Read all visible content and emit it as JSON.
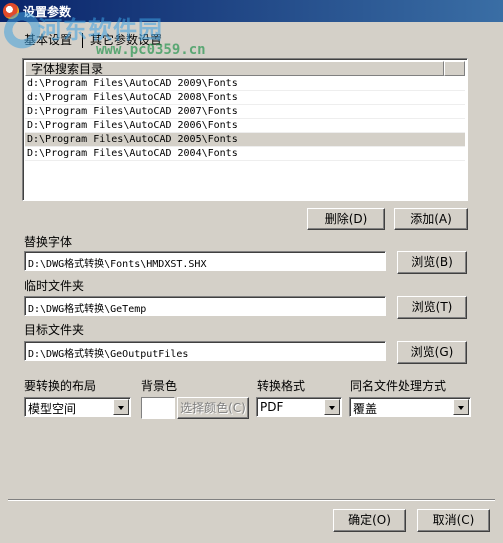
{
  "window": {
    "title": "设置参数"
  },
  "watermark": {
    "text": "河东软件园",
    "url": "www.pc0359.cn"
  },
  "tabs": [
    {
      "label": "基本设置"
    },
    {
      "label": "其它参数设置"
    }
  ],
  "font_dirs": {
    "header": "字体搜索目录",
    "rows": [
      "d:\\Program Files\\AutoCAD 2009\\Fonts",
      "d:\\Program Files\\AutoCAD 2008\\Fonts",
      "D:\\Program Files\\AutoCAD 2007\\Fonts",
      "D:\\Program Files\\AutoCAD 2006\\Fonts",
      "D:\\Program Files\\AutoCAD 2005\\Fonts",
      "D:\\Program Files\\AutoCAD 2004\\Fonts"
    ],
    "selected_index": 4,
    "delete_label": "删除(D)",
    "add_label": "添加(A)"
  },
  "replace_font": {
    "label": "替换字体",
    "value": "D:\\DWG格式转换\\Fonts\\HMDXST.SHX",
    "browse_label": "浏览(B)"
  },
  "temp_folder": {
    "label": "临时文件夹",
    "value": "D:\\DWG格式转换\\GeTemp",
    "browse_label": "浏览(T)"
  },
  "target_folder": {
    "label": "目标文件夹",
    "value": "D:\\DWG格式转换\\GeOutputFiles",
    "browse_label": "浏览(G)"
  },
  "layout": {
    "label": "要转换的布局",
    "value": "模型空间"
  },
  "background": {
    "label": "背景色",
    "button_label": "选择颜色(C)",
    "color": "#ffffff"
  },
  "format": {
    "label": "转换格式",
    "value": "PDF"
  },
  "same_name": {
    "label": "同名文件处理方式",
    "value": "覆盖"
  },
  "footer": {
    "ok_label": "确定(O)",
    "cancel_label": "取消(C)"
  }
}
